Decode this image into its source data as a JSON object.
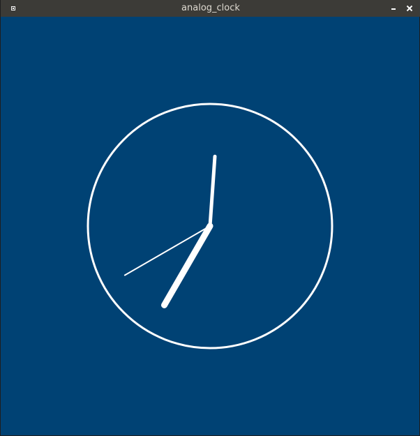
{
  "window": {
    "title": "analog_clock"
  },
  "colors": {
    "background": "#004274",
    "titlebar": "#3c3b37",
    "foreground": "#ffffff"
  },
  "icons": {
    "menu": "window-menu-icon",
    "minimize": "minimize-icon",
    "close": "close-icon"
  },
  "clock": {
    "hour": 7,
    "minute": 0,
    "second": 40
  }
}
